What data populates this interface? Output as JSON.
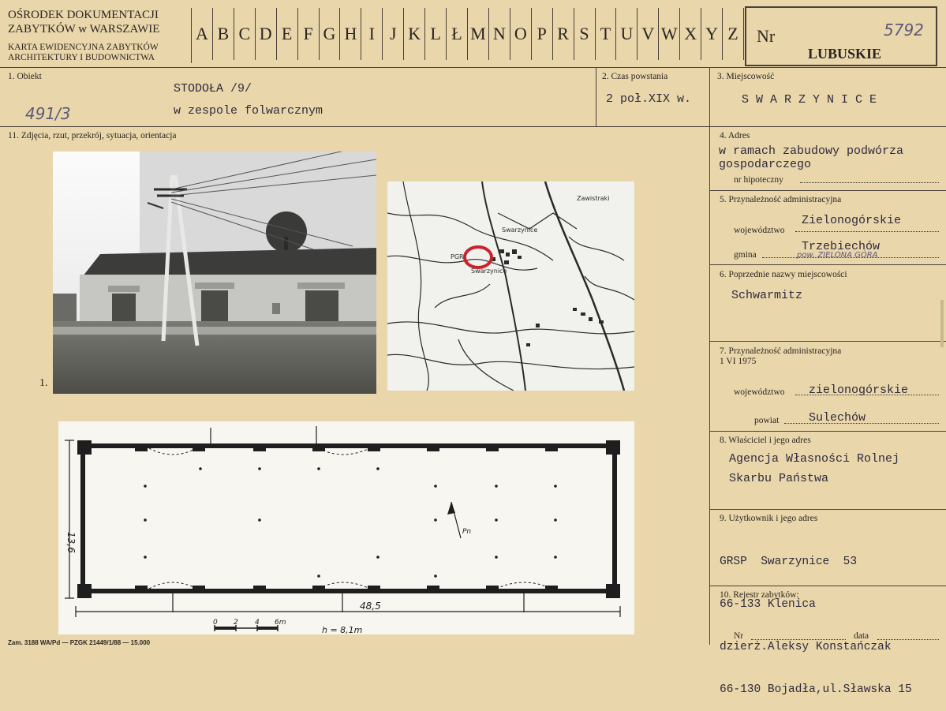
{
  "header": {
    "org_line1": "OŚRODEK DOKUMENTACJI",
    "org_line2": "ZABYTKÓW w WARSZAWIE",
    "card_line1": "KARTA EWIDENCYJNA ZABYTKÓW",
    "card_line2": "ARCHITEKTURY I BUDOWNICTWA",
    "letters": [
      "A",
      "B",
      "C",
      "D",
      "E",
      "F",
      "G",
      "H",
      "I",
      "J",
      "K",
      "L",
      "Ł",
      "M",
      "N",
      "O",
      "P",
      "R",
      "S",
      "T",
      "U",
      "V",
      "W",
      "X",
      "Y",
      "Z"
    ],
    "nr_label": "Nr",
    "nr_handwritten": "5792",
    "region": "LUBUSKIE"
  },
  "obiekt": {
    "label": "1. Obiekt",
    "line1": "STODOŁA /9/",
    "line2": "w zespole folwarcznym",
    "hand_note": "491/3"
  },
  "czas": {
    "label": "2. Czas powstania",
    "value": "2 poł.XIX w."
  },
  "miejscowosc": {
    "label": "3. Miejscowość",
    "value": "S W A R Z Y N I C E"
  },
  "zdjecia": {
    "label": "11. Zdjęcia, rzut, przekrój, sytuacja, orientacja",
    "photo_number": "1.",
    "map_labels": [
      "Swarzynice",
      "Zawistraki",
      "PGR",
      "Swarzynice"
    ],
    "plan": {
      "width_label": "48,5",
      "depth_label": "13,6",
      "height_label": "h = 8,1m",
      "scale_ticks": [
        "0",
        "2",
        "4",
        "6m"
      ],
      "north_label": "Pn"
    }
  },
  "adres": {
    "label": "4. Adres",
    "value": "w ramach zabudowy podwórza gospodarczego",
    "hip_label": "nr hipoteczny"
  },
  "przyn1": {
    "label": "5. Przynależność administracyjna",
    "woj_label": "województwo",
    "woj_value": "Zielonogórskie",
    "gmina_label": "gmina",
    "gmina_value": "Trzebiechów",
    "hand_note": "pow. ZIELONA GÓRA"
  },
  "poprzednie": {
    "label": "6. Poprzednie nazwy miejscowości",
    "value": "Schwarmitz"
  },
  "przyn2": {
    "label": "7. Przynależność administracyjna",
    "date": "1 VI 1975",
    "woj_label": "województwo",
    "woj_value": "zielonogórskie",
    "powiat_label": "powiat",
    "powiat_value": "Sulechów"
  },
  "wlasciciel": {
    "label": "8. Właściciel i jego adres",
    "line1": "Agencja Własności Rolnej",
    "line2": "Skarbu Państwa"
  },
  "uzytkownik": {
    "label": "9. Użytkownik i jego adres",
    "line1": "GRSP  Swarzynice  53",
    "line2": "66-133 Klenica",
    "line3": "dzierż.Aleksy Konstańczak",
    "line4": "66-130 Bojadła,ul.Sławska 15"
  },
  "rejestr": {
    "label": "10. Rejestr zabytków:",
    "nr_label": "Nr",
    "data_label": "data"
  },
  "footer": {
    "print_info": "Zam. 3188 WA/Pd — PZGK 21449/1/88 — 15.000"
  }
}
